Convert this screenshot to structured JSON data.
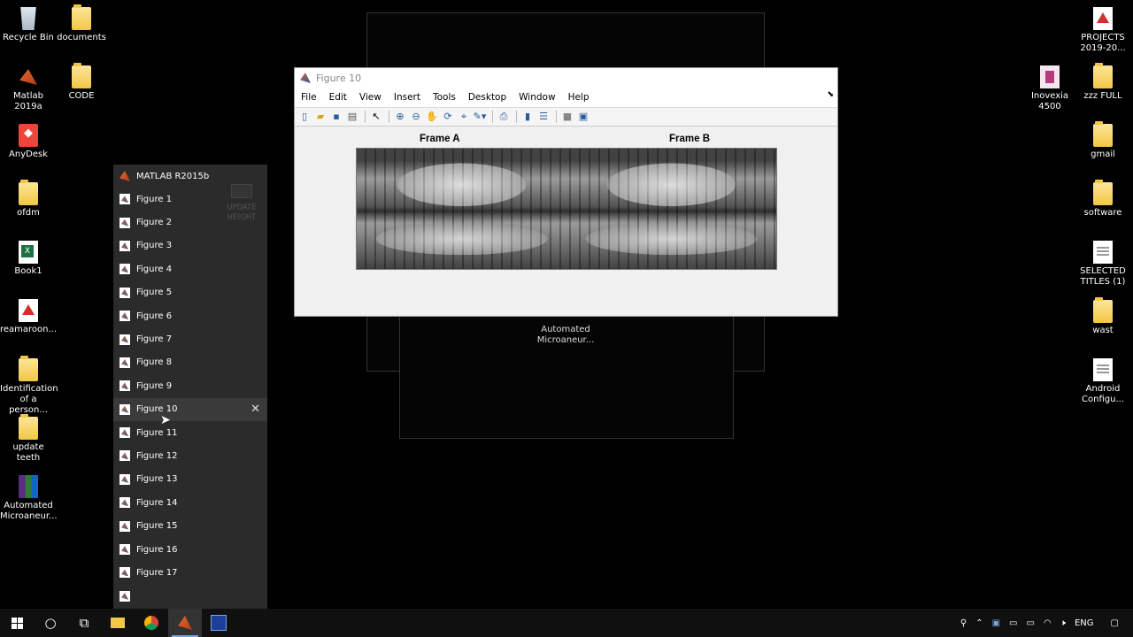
{
  "desktop_left": [
    {
      "label": "Recycle Bin",
      "icon": "recycle-bin-icon"
    },
    {
      "label": "documents",
      "icon": "folder-icon"
    },
    {
      "label": "Matlab 2019a",
      "icon": "matlab-icon"
    },
    {
      "label": "CODE",
      "icon": "folder-icon"
    },
    {
      "label": "AnyDesk",
      "icon": "anydesk-icon"
    },
    {
      "label": "ofdm",
      "icon": "folder-icon"
    },
    {
      "label": "Book1",
      "icon": "excel-icon"
    },
    {
      "label": "reamaroon...",
      "icon": "pdf-icon"
    },
    {
      "label": "Identification of a person...",
      "icon": "folder-icon"
    },
    {
      "label": "update teeth",
      "icon": "folder-icon"
    },
    {
      "label": "Automated Microaneur...",
      "icon": "winrar-icon"
    }
  ],
  "desktop_right": [
    {
      "label": "PROJECTS 2019-20...",
      "icon": "pdf-icon"
    },
    {
      "label": "Inovexia 4500",
      "icon": "app-icon"
    },
    {
      "label": "zzz FULL",
      "icon": "folder-icon"
    },
    {
      "label": "gmail",
      "icon": "folder-icon"
    },
    {
      "label": "software",
      "icon": "folder-icon"
    },
    {
      "label": "SELECTED TITLES (1)",
      "icon": "document-icon"
    },
    {
      "label": "wast",
      "icon": "folder-icon"
    },
    {
      "label": "Android Configu...",
      "icon": "document-icon"
    }
  ],
  "ghost_label": "Automated Microaneur...",
  "figure_window": {
    "title": "Figure 10",
    "menu": [
      "File",
      "Edit",
      "View",
      "Insert",
      "Tools",
      "Desktop",
      "Window",
      "Help"
    ],
    "axes": [
      {
        "title": "Frame A"
      },
      {
        "title": "Frame B"
      }
    ]
  },
  "jumplist": {
    "app_title": "MATLAB R2015b",
    "items": [
      "Figure 1",
      "Figure 2",
      "Figure 3",
      "Figure 4",
      "Figure 5",
      "Figure 6",
      "Figure 7",
      "Figure 8",
      "Figure 9",
      "Figure 10",
      "Figure 11",
      "Figure 12",
      "Figure 13",
      "Figure 14",
      "Figure 15",
      "Figure 16",
      "Figure 17"
    ],
    "hover_item": "Figure 10",
    "thumbnail_label": "UPDATE HEIGHT"
  },
  "taskbar": {
    "language": "ENG"
  }
}
